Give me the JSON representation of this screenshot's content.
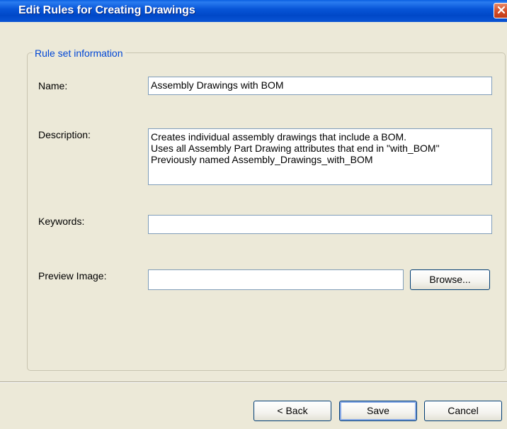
{
  "window": {
    "title": "Edit Rules for Creating Drawings"
  },
  "group": {
    "title": "Rule set information"
  },
  "fields": {
    "name_label": "Name:",
    "name_value": "Assembly Drawings with BOM",
    "description_label": "Description:",
    "description_lines": [
      "Creates individual assembly drawings that include a BOM.",
      "Uses all Assembly Part Drawing attributes that end in \"with_BOM\"",
      "Previously named Assembly_Drawings_with_BOM"
    ],
    "keywords_label": "Keywords:",
    "keywords_value": "",
    "preview_label": "Preview Image:",
    "preview_value": ""
  },
  "buttons": {
    "browse": "Browse...",
    "back": "< Back",
    "save": "Save",
    "cancel": "Cancel"
  },
  "icons": {
    "close": "close-icon"
  },
  "colors": {
    "titlebar": "#0054e3",
    "group_title": "#0046d5",
    "face": "#ece9d8",
    "close": "#d4502a"
  }
}
